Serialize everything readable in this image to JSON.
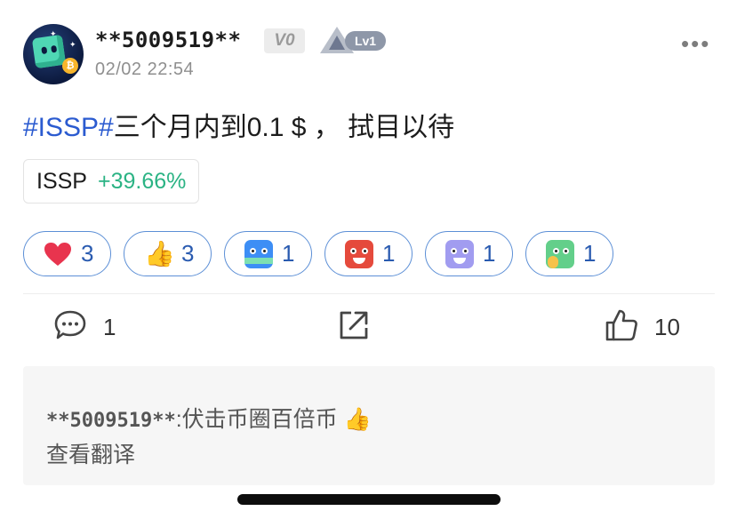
{
  "post": {
    "username": "**5009519**",
    "vip_badge": "V0",
    "level_badge": "Lv1",
    "timestamp": "02/02 22:54",
    "more_icon": "more-dots-icon",
    "content": {
      "hashtag": "#ISSP#",
      "text": "三个月内到0.1 $ ， 拭目以待"
    },
    "ticker": {
      "symbol": "ISSP",
      "change": "+39.66%",
      "change_color": "#2bb384"
    },
    "reactions": [
      {
        "icon": "heart-icon",
        "count": "3"
      },
      {
        "icon": "thumbs-up-icon",
        "count": "3"
      },
      {
        "icon": "hodl-face-icon",
        "count": "1"
      },
      {
        "icon": "angry-face-icon",
        "count": "1"
      },
      {
        "icon": "cold-face-icon",
        "count": "1"
      },
      {
        "icon": "worried-face-icon",
        "count": "1"
      }
    ],
    "actions": {
      "comments": "1",
      "likes": "10"
    },
    "top_comment": {
      "author": "**5009519**",
      "separator": ":",
      "text": "伏击币圈百倍币",
      "emoji": "👍",
      "translate_label": "查看翻译"
    },
    "colors": {
      "hashtag": "#2b5bd0",
      "reaction_border": "#5c8fd6",
      "reaction_count": "#2a5bb0"
    }
  }
}
